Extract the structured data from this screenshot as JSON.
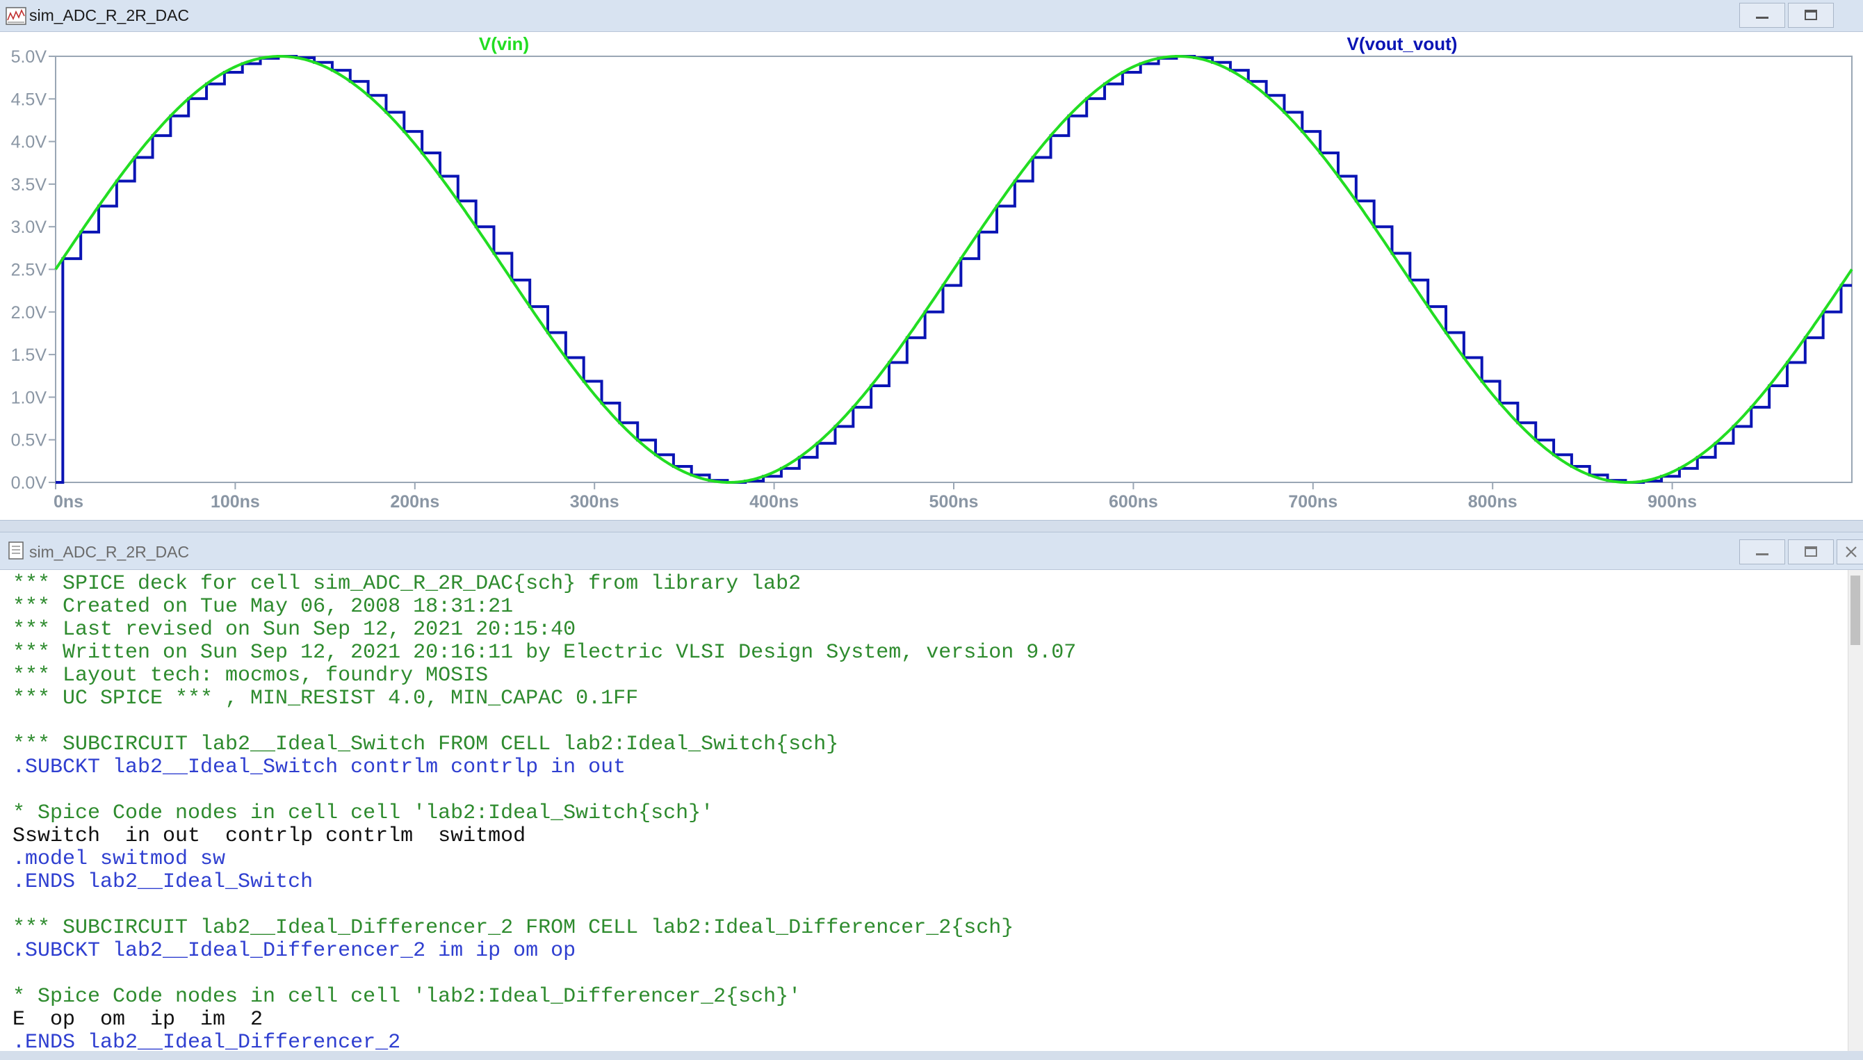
{
  "waveform_window": {
    "title": "sim_ADC_R_2R_DAC",
    "icon": "waveform-icon",
    "buttons": [
      "minimize-icon",
      "maximize-icon"
    ]
  },
  "netlist_window": {
    "title": "sim_ADC_R_2R_DAC",
    "icon": "document-icon",
    "buttons": [
      "minimize-icon",
      "maximize-icon",
      "close-icon"
    ]
  },
  "colors": {
    "vin": "#22dd22",
    "vout": "#0a14b4",
    "axis": "#9aa6b4",
    "comment": "#2e8b2e",
    "directive": "#2f3fd0",
    "code": "#111111"
  },
  "chart_data": {
    "type": "line",
    "title": "",
    "xlabel": "",
    "ylabel": "",
    "xlim": [
      0,
      1000
    ],
    "ylim": [
      0,
      5.0
    ],
    "x_unit": "ns",
    "y_unit": "V",
    "x_tick_labels": [
      "0ns",
      "100ns",
      "200ns",
      "300ns",
      "400ns",
      "500ns",
      "600ns",
      "700ns",
      "800ns",
      "900ns"
    ],
    "y_tick_labels": [
      "5.0V",
      "4.5V",
      "4.0V",
      "3.5V",
      "3.0V",
      "2.5V",
      "2.0V",
      "1.5V",
      "1.0V",
      "0.5V",
      "0.0V"
    ],
    "grid": false,
    "series": [
      {
        "name": "V(vin)",
        "color": "#22dd22",
        "kind": "sine",
        "offset": 2.5,
        "amplitude": 2.5,
        "period_ns": 500,
        "phase_deg": 0
      },
      {
        "name": "V(vout_vout)",
        "color": "#0a14b4",
        "kind": "staircase",
        "sample_step_ns": 10,
        "start_ns": 4,
        "quantization": "sampled V(vin) held between samples, 0V before first sample"
      }
    ]
  },
  "netlist": {
    "lines": [
      {
        "t": "*** SPICE deck for cell sim_ADC_R_2R_DAC{sch} from library lab2",
        "k": "comment"
      },
      {
        "t": "*** Created on Tue May 06, 2008 18:31:21",
        "k": "comment"
      },
      {
        "t": "*** Last revised on Sun Sep 12, 2021 20:15:40",
        "k": "comment"
      },
      {
        "t": "*** Written on Sun Sep 12, 2021 20:16:11 by Electric VLSI Design System, version 9.07",
        "k": "comment"
      },
      {
        "t": "*** Layout tech: mocmos, foundry MOSIS",
        "k": "comment"
      },
      {
        "t": "*** UC SPICE *** , MIN_RESIST 4.0, MIN_CAPAC 0.1FF",
        "k": "comment"
      },
      {
        "t": "",
        "k": "code"
      },
      {
        "t": "*** SUBCIRCUIT lab2__Ideal_Switch FROM CELL lab2:Ideal_Switch{sch}",
        "k": "comment"
      },
      {
        "t": ".SUBCKT lab2__Ideal_Switch contrlm contrlp in out",
        "k": "directive"
      },
      {
        "t": "",
        "k": "code"
      },
      {
        "t": "* Spice Code nodes in cell cell 'lab2:Ideal_Switch{sch}'",
        "k": "comment"
      },
      {
        "t": "Sswitch  in out  contrlp contrlm  switmod",
        "k": "code"
      },
      {
        "t": ".model switmod sw",
        "k": "directive"
      },
      {
        "t": ".ENDS lab2__Ideal_Switch",
        "k": "directive"
      },
      {
        "t": "",
        "k": "code"
      },
      {
        "t": "*** SUBCIRCUIT lab2__Ideal_Differencer_2 FROM CELL lab2:Ideal_Differencer_2{sch}",
        "k": "comment"
      },
      {
        "t": ".SUBCKT lab2__Ideal_Differencer_2 im ip om op",
        "k": "directive"
      },
      {
        "t": "",
        "k": "code"
      },
      {
        "t": "* Spice Code nodes in cell cell 'lab2:Ideal_Differencer_2{sch}'",
        "k": "comment"
      },
      {
        "t": "E  op  om  ip  im  2",
        "k": "code"
      },
      {
        "t": ".ENDS lab2__Ideal_Differencer_2",
        "k": "directive"
      }
    ]
  }
}
